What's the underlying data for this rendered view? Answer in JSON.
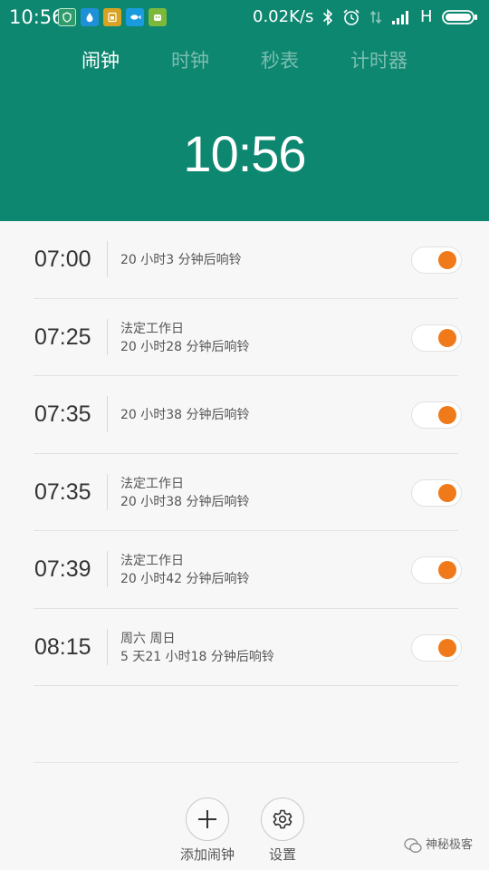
{
  "status_bar": {
    "time": "10:56",
    "net_speed": "0.02K/s",
    "network_type": "H",
    "left_icons": [
      "shield-app-icon",
      "drop-app-icon",
      "sim-app-icon",
      "fish-app-icon",
      "robot-app-icon"
    ],
    "right_icons": [
      "bluetooth-icon",
      "alarm-clock-icon",
      "data-arrows-icon",
      "signal-icon",
      "battery-icon"
    ]
  },
  "tabs": [
    {
      "label": "闹钟",
      "active": true
    },
    {
      "label": "时钟",
      "active": false
    },
    {
      "label": "秒表",
      "active": false
    },
    {
      "label": "计时器",
      "active": false
    }
  ],
  "current_time": "10:56",
  "alarms": [
    {
      "time": "07:00",
      "repeat": "",
      "countdown": "20 小时3 分钟后响铃",
      "enabled": true
    },
    {
      "time": "07:25",
      "repeat": "法定工作日",
      "countdown": "20 小时28 分钟后响铃",
      "enabled": true
    },
    {
      "time": "07:35",
      "repeat": "",
      "countdown": "20 小时38 分钟后响铃",
      "enabled": true
    },
    {
      "time": "07:35",
      "repeat": "法定工作日",
      "countdown": "20 小时38 分钟后响铃",
      "enabled": true
    },
    {
      "time": "07:39",
      "repeat": "法定工作日",
      "countdown": "20 小时42 分钟后响铃",
      "enabled": true
    },
    {
      "time": "08:15",
      "repeat": "周六 周日",
      "countdown": "5 天21 小时18 分钟后响铃",
      "enabled": true
    }
  ],
  "actions": {
    "add_label": "添加闹钟",
    "settings_label": "设置"
  },
  "watermark": "神秘极客",
  "colors": {
    "header": "#0e8770",
    "toggle_on": "#f07a1a",
    "background": "#f7f7f7"
  }
}
